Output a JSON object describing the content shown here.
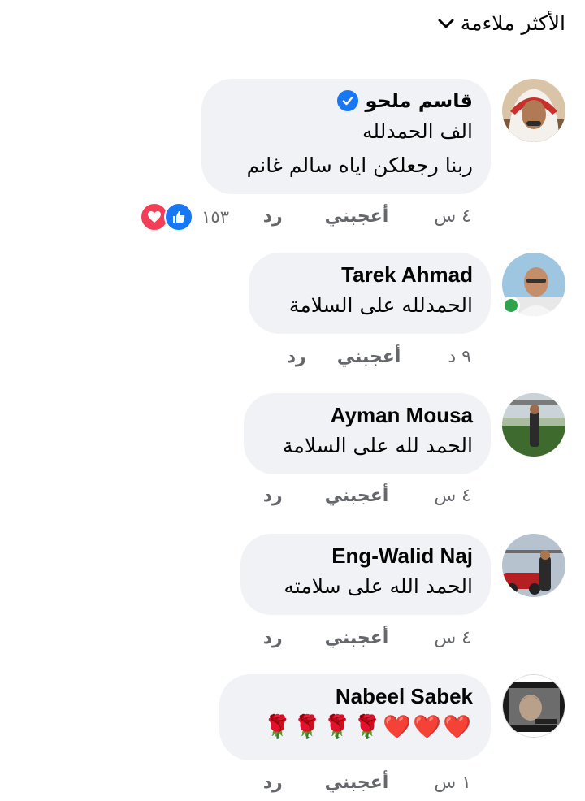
{
  "sort": {
    "label": "الأكثر ملاءمة",
    "icon": "chevron-down-icon"
  },
  "comments": [
    {
      "author": "قاسم ملحو",
      "verified": true,
      "lines": [
        "الف الحمدلله",
        "ربنا رجعلكن اياه سالم غانم"
      ],
      "time": "٤ س",
      "like_label": "أعجبني",
      "reply_label": "رد",
      "reaction_count": "١٥٣"
    },
    {
      "author": "Tarek Ahmad",
      "online": true,
      "lines": [
        "الحمدلله على السلامة"
      ],
      "time": "٩ د",
      "like_label": "أعجبني",
      "reply_label": "رد"
    },
    {
      "author": "Ayman Mousa",
      "lines": [
        "الحمد لله على السلامة"
      ],
      "time": "٤ س",
      "like_label": "أعجبني",
      "reply_label": "رد"
    },
    {
      "author": "Eng-Walid Naj",
      "lines": [
        "الحمد الله على سلامته"
      ],
      "time": "٤ س",
      "like_label": "أعجبني",
      "reply_label": "رد"
    },
    {
      "author": "Nabeel Sabek",
      "lines": [
        "❤️❤️❤️🌹🌹🌹🌹"
      ],
      "time": "١ س",
      "like_label": "أعجبني",
      "reply_label": "رد"
    }
  ],
  "colors": {
    "bubble": "#f0f2f5",
    "muted_text": "#65676b",
    "verified": "#1877f2",
    "like": "#1877f2",
    "love": "#f33e58",
    "online": "#31a24c"
  }
}
